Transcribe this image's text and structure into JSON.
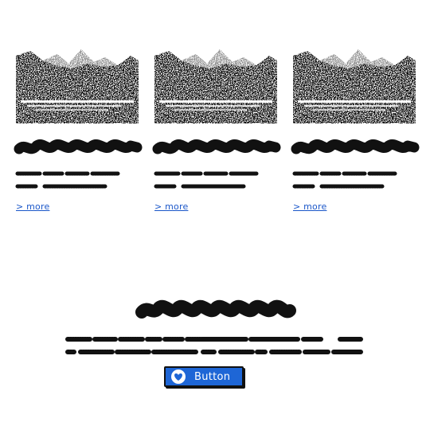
{
  "cards": [
    {
      "more_label": "> more"
    },
    {
      "more_label": "> more"
    },
    {
      "more_label": "> more"
    }
  ],
  "hero": {
    "button_label": "Button",
    "button_icon": "heart-icon"
  },
  "colors": {
    "link": "#1b57c9",
    "button_bg": "#1e66d6",
    "button_text": "#ffffff",
    "scribble": "#111111"
  }
}
